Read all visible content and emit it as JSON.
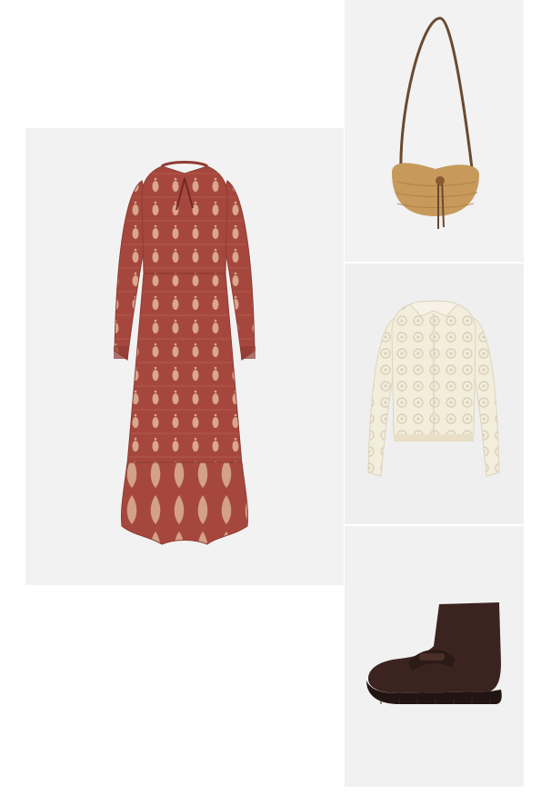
{
  "outfit": {
    "items": [
      {
        "name": "dress",
        "color": "#a6473d",
        "background": "#f2f2f2"
      },
      {
        "name": "bag",
        "color": "#c79a5c",
        "background": "#f2f2f2"
      },
      {
        "name": "cardigan",
        "color": "#f3eddc",
        "background": "#efefef"
      },
      {
        "name": "boot",
        "color": "#3b2420",
        "background": "#f1f1f1"
      }
    ]
  },
  "colors": {
    "page": "#ffffff",
    "dress_pattern": "#e8c7a9",
    "bag_strap": "#6b4a2f"
  }
}
